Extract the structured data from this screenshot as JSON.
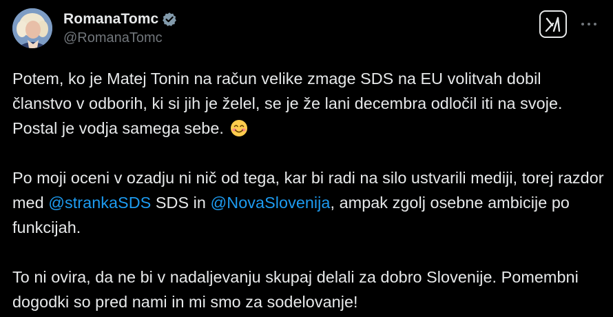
{
  "author": {
    "display_name": "RomanaTomc",
    "handle": "@RomanaTomc",
    "verified": true,
    "verified_color": "#829aab"
  },
  "actions": {
    "grok_icon": "grok-icon",
    "more_icon": "more-horizontal-icon"
  },
  "tweet": {
    "p1": "Potem, ko je Matej Tonin na račun velike zmage SDS na EU volitvah dobil članstvo v odborih, ki si jih je želel, se je že lani decembra odločil iti na svoje. Postal je vodja samega sebe.",
    "p1_emoji": "smiling-face-with-smiling-eyes",
    "p2_a": "Po moji oceni v ozadju ni nič od tega, kar bi radi na silo ustvarili mediji, torej razdor med ",
    "p2_mention1": "@strankaSDS",
    "p2_b": " SDS in ",
    "p2_mention2": "@NovaSlovenija",
    "p2_c": ", ampak zgolj osebne ambicije po funkcijah.",
    "p3": "To ni ovira, da ne bi v nadaljevanju skupaj delali za dobro Slovenije. Pomembni dogodki so pred nami in mi smo za sodelovanje!"
  },
  "colors": {
    "background": "#000000",
    "text": "#e7e9ea",
    "secondary": "#71767b",
    "link": "#1d9bf0"
  }
}
